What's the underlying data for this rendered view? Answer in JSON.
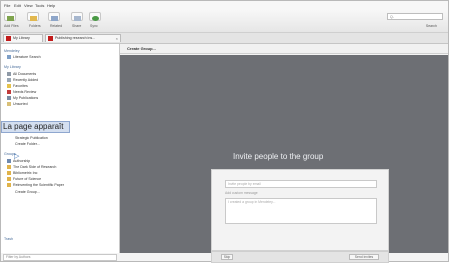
{
  "menu": [
    "File",
    "Edit",
    "View",
    "Tools",
    "Help"
  ],
  "toolbar": {
    "buttons": [
      {
        "label": "Add Files",
        "icon": "add-files-icon"
      },
      {
        "label": "Folders",
        "icon": "folder-icon"
      },
      {
        "label": "Related",
        "icon": "related-icon"
      },
      {
        "label": "Share",
        "icon": "share-icon"
      },
      {
        "label": "Sync",
        "icon": "sync-icon"
      }
    ],
    "search_label": "Search",
    "search_placeholder": "Q-"
  },
  "tabs": [
    {
      "label": "My Library"
    },
    {
      "label": "Publishing research ins..."
    }
  ],
  "sidebar": {
    "mendeley_head": "Mendeley",
    "literature_search": "Literature Search",
    "my_library_head": "My Library",
    "library_items": [
      "All Documents",
      "Recently Added",
      "Favorites",
      "Needs Review",
      "My Publications",
      "Unsorted"
    ],
    "extra_items": [
      "Strategic Publication",
      "Create Folder..."
    ],
    "groups_head": "Groups",
    "groups": [
      "Authorship",
      "The Dark Side of Research",
      "Bibliometrix Inc",
      "Future of Science",
      "Reinventing the Scientific Paper",
      "Create Group..."
    ],
    "trash": "Trash",
    "filter_placeholder": "Filter by Authors",
    "tooltip": "La page apparaît"
  },
  "main": {
    "header": "Create Group...",
    "invite_title": "Invite people to the group",
    "email_placeholder": "Invite people by email",
    "message_label": "Add custom message",
    "message_placeholder": "I created a group in Mendeley...",
    "skip_label": "Skip",
    "send_label": "Send invites"
  },
  "colors": {
    "accent": "#c21b1b",
    "panel": "#6d6f74",
    "link": "#466b99"
  }
}
